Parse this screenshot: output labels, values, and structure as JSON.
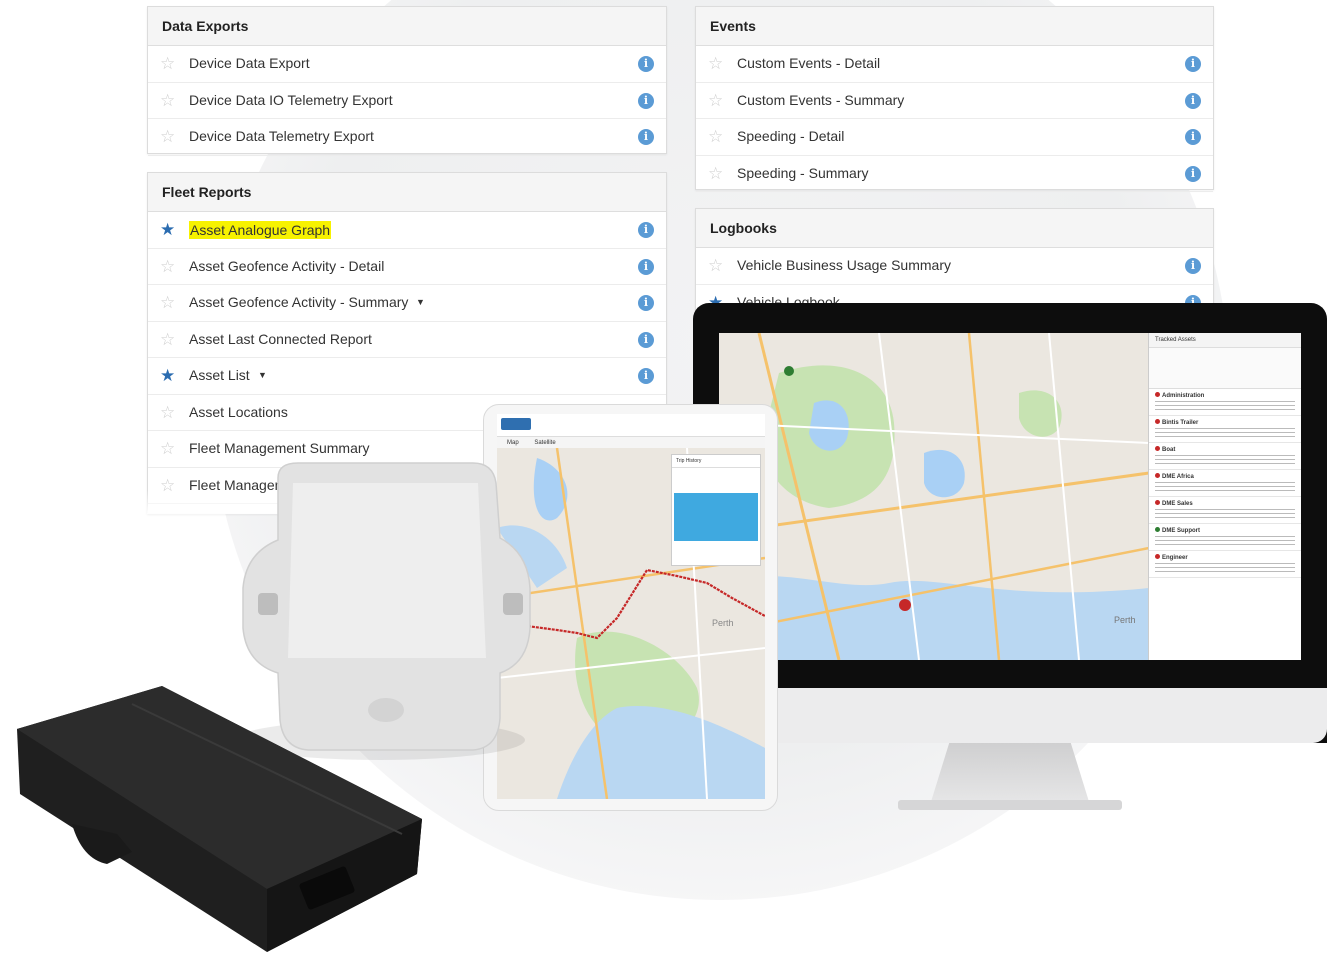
{
  "data_exports": {
    "title": "Data Exports",
    "items": [
      {
        "label": "Device Data Export",
        "starred": false
      },
      {
        "label": "Device Data IO Telemetry Export",
        "starred": false
      },
      {
        "label": "Device Data Telemetry Export",
        "starred": false
      }
    ]
  },
  "events": {
    "title": "Events",
    "items": [
      {
        "label": "Custom Events - Detail",
        "starred": false
      },
      {
        "label": "Custom Events - Summary",
        "starred": false
      },
      {
        "label": "Speeding - Detail",
        "starred": false
      },
      {
        "label": "Speeding - Summary",
        "starred": false
      }
    ]
  },
  "fleet_reports": {
    "title": "Fleet Reports",
    "items": [
      {
        "label": "Asset Analogue Graph",
        "starred": true,
        "highlighted": true
      },
      {
        "label": "Asset Geofence Activity - Detail",
        "starred": false
      },
      {
        "label": "Asset Geofence Activity - Summary",
        "starred": false,
        "dropdown": true
      },
      {
        "label": "Asset Last Connected Report",
        "starred": false
      },
      {
        "label": "Asset List",
        "starred": true,
        "dropdown": true
      },
      {
        "label": "Asset Locations",
        "starred": false
      },
      {
        "label": "Fleet Management Summary",
        "starred": false
      },
      {
        "label": "Fleet Managemer",
        "starred": false
      }
    ]
  },
  "logbooks": {
    "title": "Logbooks",
    "items": [
      {
        "label": "Vehicle Business Usage Summary",
        "starred": false
      },
      {
        "label": "Vehicle Logbook",
        "starred": true
      }
    ]
  },
  "monitor": {
    "panel_title": "Tracked Assets",
    "assets": [
      {
        "name": "Administration",
        "status": "red"
      },
      {
        "name": "Bintis Trailer",
        "status": "red"
      },
      {
        "name": "Boat",
        "status": "red"
      },
      {
        "name": "DME Africa",
        "status": "red"
      },
      {
        "name": "DME Sales",
        "status": "red"
      },
      {
        "name": "DME Support",
        "status": "green"
      },
      {
        "name": "Engineer",
        "status": "red"
      }
    ],
    "map_labels": [
      "Perth"
    ]
  },
  "tablet": {
    "tabs": [
      "Map",
      "Satellite"
    ],
    "trip_title": "Trip History",
    "map_label": "Perth"
  },
  "colors": {
    "accent_blue": "#2b6cb0",
    "info_blue": "#5b9bd5",
    "highlight": "#f7f200",
    "route_red": "#c62828"
  }
}
